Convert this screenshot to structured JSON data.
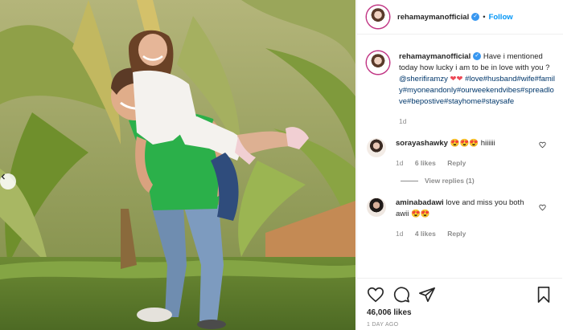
{
  "post": {
    "username": "rehamaymanofficial",
    "follow_label": "Follow",
    "caption": {
      "text": "Have i mentioned today how lucky i am to be in love with you ?",
      "mention": "@sherifiramzy",
      "hearts": "❤❤",
      "hashtags": "#love#husband#wife#family#myoneandonly#ourweekendvibes#spreadlove#bepostive#stayhome#staysafe",
      "age": "1d"
    },
    "likes": "46,006 likes",
    "posted_ago": "1 DAY AGO"
  },
  "comments": [
    {
      "username": "sorayashawky",
      "text": "😍😍😍 hiiiiii",
      "age": "1d",
      "likes": "6 likes",
      "reply": "Reply",
      "view_replies": "View replies (1)"
    },
    {
      "username": "aminabadawi",
      "text": "love and miss you both awii 😍😍",
      "age": "1d",
      "likes": "4 likes",
      "reply": "Reply"
    }
  ],
  "colors": {
    "accent": "#0095f6",
    "verified": "#3897f0",
    "heart": "#ed4956",
    "muted": "#8e8e8e"
  },
  "icons": [
    "heart-icon",
    "comment-icon",
    "share-icon",
    "bookmark-icon",
    "verified-badge-icon",
    "chevron-left-icon"
  ]
}
